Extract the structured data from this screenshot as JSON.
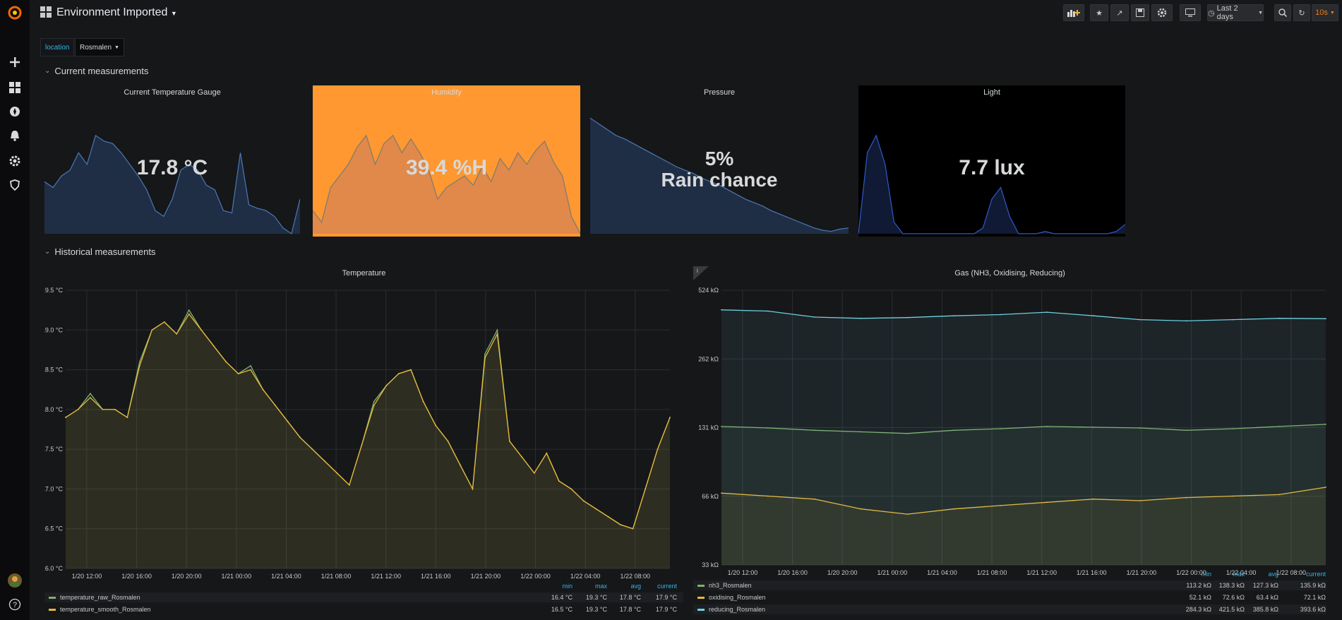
{
  "app": {
    "title": "Environment Imported"
  },
  "toolbar": {
    "time_range": "Last 2 days",
    "refresh_interval": "10s"
  },
  "variables": [
    {
      "label": "location",
      "value": "Rosmalen"
    }
  ],
  "rows": [
    {
      "title": "Current measurements"
    },
    {
      "title": "Historical measurements"
    }
  ],
  "stats": [
    {
      "title": "Current Temperature Gauge",
      "value": "17.8 °C",
      "background": "#161719",
      "spark_fill": "#1f2e44",
      "spark_line": "#4a78b8",
      "spark": [
        0.45,
        0.4,
        0.5,
        0.55,
        0.7,
        0.6,
        0.85,
        0.8,
        0.78,
        0.7,
        0.6,
        0.5,
        0.38,
        0.2,
        0.15,
        0.3,
        0.55,
        0.6,
        0.55,
        0.42,
        0.38,
        0.2,
        0.18,
        0.7,
        0.25,
        0.22,
        0.2,
        0.15,
        0.05,
        0.0,
        0.3
      ]
    },
    {
      "title": "Humidity",
      "value": "39.4 %H",
      "background": "#ff9830",
      "spark_fill": "#e0894a",
      "spark_line": "#7c7a73",
      "spark": [
        0.2,
        0.1,
        0.4,
        0.5,
        0.6,
        0.75,
        0.85,
        0.6,
        0.78,
        0.85,
        0.7,
        0.82,
        0.7,
        0.55,
        0.3,
        0.4,
        0.45,
        0.5,
        0.42,
        0.58,
        0.45,
        0.65,
        0.55,
        0.7,
        0.6,
        0.72,
        0.8,
        0.62,
        0.5,
        0.15,
        0.0
      ]
    },
    {
      "title": "Pressure",
      "value_line1": "5%",
      "value_line2": "Rain chance",
      "background": "#161719",
      "spark_fill": "#1f2e44",
      "spark_line": "#4a78b8",
      "spark": [
        1.0,
        0.95,
        0.9,
        0.85,
        0.82,
        0.78,
        0.74,
        0.7,
        0.66,
        0.62,
        0.58,
        0.55,
        0.52,
        0.48,
        0.45,
        0.42,
        0.38,
        0.34,
        0.3,
        0.27,
        0.24,
        0.2,
        0.17,
        0.14,
        0.11,
        0.08,
        0.05,
        0.03,
        0.02,
        0.04,
        0.05
      ]
    },
    {
      "title": "Light",
      "value": "7.7 lux",
      "background": "#000000",
      "spark_fill": "#101a34",
      "spark_line": "#2f5ac8",
      "spark": [
        0.0,
        0.7,
        0.85,
        0.6,
        0.1,
        0.0,
        0.0,
        0.0,
        0.0,
        0.0,
        0.0,
        0.0,
        0.0,
        0.0,
        0.05,
        0.3,
        0.4,
        0.15,
        0.0,
        0.0,
        0.0,
        0.02,
        0.0,
        0.0,
        0.0,
        0.0,
        0.0,
        0.0,
        0.0,
        0.02,
        0.08
      ]
    }
  ],
  "temperature_panel": {
    "title": "Temperature",
    "y_ticks": [
      "19.5 °C",
      "19.0 °C",
      "18.5 °C",
      "18.0 °C",
      "17.5 °C",
      "17.0 °C",
      "16.5 °C",
      "16.0 °C"
    ],
    "x_ticks": [
      "1/20 12:00",
      "1/20 16:00",
      "1/20 20:00",
      "1/21 00:00",
      "1/21 04:00",
      "1/21 08:00",
      "1/21 12:00",
      "1/21 16:00",
      "1/21 20:00",
      "1/22 00:00",
      "1/22 04:00",
      "1/22 08:00"
    ],
    "legend_headers": [
      "min",
      "max",
      "avg",
      "current"
    ],
    "legend": [
      {
        "name": "temperature_raw_Rosmalen",
        "color": "#7eb26d",
        "min": "16.4 °C",
        "max": "19.3 °C",
        "avg": "17.8 °C",
        "current": "17.9 °C"
      },
      {
        "name": "temperature_smooth_Rosmalen",
        "color": "#eab839",
        "min": "16.5 °C",
        "max": "19.3 °C",
        "avg": "17.8 °C",
        "current": "17.9 °C"
      }
    ]
  },
  "gas_panel": {
    "title": "Gas (NH3, Oxidising, Reducing)",
    "info_icon": "i",
    "y_ticks": [
      "524 kΩ",
      "262 kΩ",
      "131 kΩ",
      "66 kΩ",
      "33 kΩ"
    ],
    "x_ticks": [
      "1/20 12:00",
      "1/20 16:00",
      "1/20 20:00",
      "1/21 00:00",
      "1/21 04:00",
      "1/21 08:00",
      "1/21 12:00",
      "1/21 16:00",
      "1/21 20:00",
      "1/22 00:00",
      "1/22 04:00",
      "1/22 08:00"
    ],
    "legend_headers": [
      "min",
      "max",
      "avg",
      "current"
    ],
    "legend": [
      {
        "name": "nh3_Rosmalen",
        "color": "#7eb26d",
        "min": "113.2 kΩ",
        "max": "138.3 kΩ",
        "avg": "127.3 kΩ",
        "current": "135.9 kΩ"
      },
      {
        "name": "oxidising_Rosmalen",
        "color": "#eab839",
        "min": "52.1 kΩ",
        "max": "72.6 kΩ",
        "avg": "63.4 kΩ",
        "current": "72.1 kΩ"
      },
      {
        "name": "reducing_Rosmalen",
        "color": "#6ed0e0",
        "min": "284.3 kΩ",
        "max": "421.5 kΩ",
        "avg": "385.8 kΩ",
        "current": "393.6 kΩ"
      }
    ]
  },
  "chart_data": [
    {
      "type": "line",
      "title": "Temperature",
      "x": [
        "1/20 09:00",
        "1/20 10:00",
        "1/20 11:00",
        "1/20 12:00",
        "1/20 13:00",
        "1/20 14:00",
        "1/20 15:00",
        "1/20 16:00",
        "1/20 17:00",
        "1/20 18:00",
        "1/20 19:00",
        "1/20 20:00",
        "1/20 21:00",
        "1/20 22:00",
        "1/20 23:00",
        "1/21 00:00",
        "1/21 01:00",
        "1/21 02:00",
        "1/21 03:00",
        "1/21 04:00",
        "1/21 05:00",
        "1/21 06:00",
        "1/21 07:00",
        "1/21 08:00",
        "1/21 09:00",
        "1/21 10:00",
        "1/21 11:00",
        "1/21 12:00",
        "1/21 13:00",
        "1/21 14:00",
        "1/21 15:00",
        "1/21 16:00",
        "1/21 17:00",
        "1/21 18:00",
        "1/21 19:00",
        "1/21 20:00",
        "1/21 21:00",
        "1/21 22:00",
        "1/21 23:00",
        "1/22 00:00",
        "1/22 01:00",
        "1/22 02:00",
        "1/22 03:00",
        "1/22 04:00",
        "1/22 05:00",
        "1/22 06:00",
        "1/22 07:00",
        "1/22 08:00",
        "1/22 09:00",
        "1/22 10:00"
      ],
      "series": [
        {
          "name": "temperature_raw_Rosmalen",
          "values": [
            17.9,
            18.0,
            18.2,
            18.0,
            18.0,
            17.9,
            18.6,
            19.0,
            19.1,
            18.95,
            19.25,
            19.0,
            18.8,
            18.6,
            18.45,
            18.55,
            18.25,
            18.05,
            17.85,
            17.65,
            17.5,
            17.35,
            17.2,
            17.05,
            17.55,
            18.1,
            18.3,
            18.45,
            18.5,
            18.1,
            17.8,
            17.6,
            17.3,
            17.0,
            18.7,
            19.0,
            17.6,
            17.4,
            17.2,
            17.45,
            17.1,
            17.0,
            16.85,
            16.75,
            16.65,
            16.55,
            16.5,
            17.0,
            17.5,
            17.9
          ]
        },
        {
          "name": "temperature_smooth_Rosmalen",
          "values": [
            17.9,
            18.0,
            18.15,
            18.0,
            18.0,
            17.9,
            18.55,
            19.0,
            19.1,
            18.95,
            19.2,
            19.0,
            18.8,
            18.6,
            18.45,
            18.5,
            18.25,
            18.05,
            17.85,
            17.65,
            17.5,
            17.35,
            17.2,
            17.05,
            17.55,
            18.05,
            18.3,
            18.45,
            18.5,
            18.1,
            17.8,
            17.6,
            17.3,
            17.0,
            18.65,
            18.95,
            17.6,
            17.4,
            17.2,
            17.45,
            17.1,
            17.0,
            16.85,
            16.75,
            16.65,
            16.55,
            16.5,
            17.0,
            17.5,
            17.9
          ]
        }
      ],
      "ylim": [
        16.0,
        19.5
      ],
      "legend": "bottom"
    },
    {
      "type": "line",
      "title": "Gas (NH3, Oxidising, Reducing)",
      "x": [
        "1/20 09:00",
        "1/20 13:00",
        "1/20 17:00",
        "1/20 21:00",
        "1/21 01:00",
        "1/21 05:00",
        "1/21 09:00",
        "1/21 13:00",
        "1/21 17:00",
        "1/21 21:00",
        "1/22 01:00",
        "1/22 05:00",
        "1/22 09:00",
        "1/22 10:00"
      ],
      "series": [
        {
          "name": "nh3_Rosmalen",
          "values": [
            133,
            131,
            128,
            126,
            124,
            128,
            130,
            133,
            132,
            131,
            128,
            130,
            133,
            135.9
          ]
        },
        {
          "name": "oxidising_Rosmalen",
          "values": [
            68,
            66,
            64,
            58,
            55,
            58,
            60,
            62,
            64,
            63,
            65,
            66,
            67,
            72.1
          ]
        },
        {
          "name": "reducing_Rosmalen",
          "values": [
            430,
            425,
            400,
            395,
            398,
            405,
            410,
            420,
            405,
            390,
            385,
            390,
            395,
            393.6
          ]
        }
      ],
      "y_scale": "log",
      "ylim": [
        33,
        524
      ],
      "legend": "bottom"
    }
  ]
}
